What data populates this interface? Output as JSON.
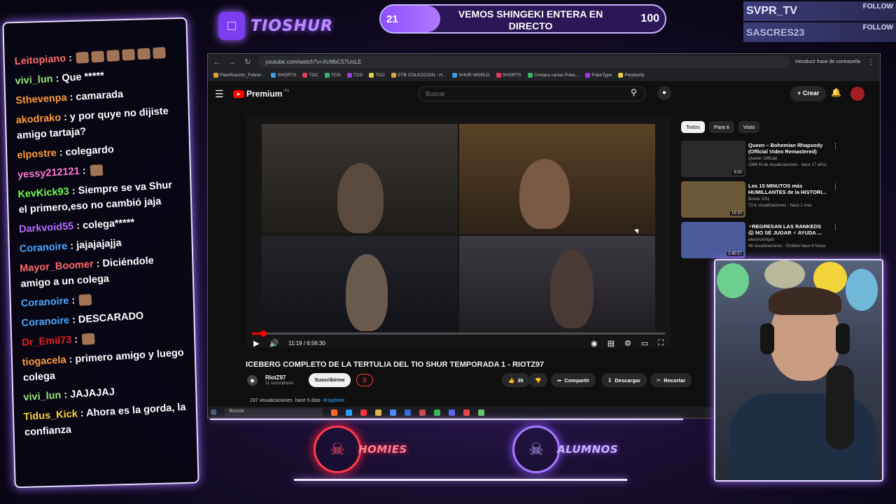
{
  "overlay": {
    "brand_name": "TIOSHUR",
    "goal": {
      "current": "21",
      "target": "100",
      "title": "VEMOS SHINGEKI ENTERA EN DIRECTO",
      "progress": 0.21
    },
    "follow": [
      {
        "name": "SVPR_TV",
        "tag": "FOLLOW"
      },
      {
        "name": "SASCRES23",
        "tag": "FOLLOW"
      }
    ],
    "badges": {
      "left": "HOMIES",
      "right": "ALUMNOS"
    }
  },
  "chat": {
    "messages": [
      {
        "user": "Leitopiano",
        "color": "#ff6a6a",
        "text": "",
        "emotes": 6
      },
      {
        "user": "vivi_lun",
        "color": "#9ae57a",
        "text": "Que *****",
        "emotes": 0
      },
      {
        "user": "Sthevenpa",
        "color": "#ff9a3c",
        "text": "camarada",
        "emotes": 0
      },
      {
        "user": "akodrako",
        "color": "#ff9a3c",
        "text": "y por quye no dijiste amigo tartaja?",
        "emotes": 0
      },
      {
        "user": "elpostre",
        "color": "#ff9a3c",
        "text": "colegardo",
        "emotes": 0
      },
      {
        "user": "yessy212121",
        "color": "#ff7ad9",
        "text": "",
        "emotes": 1
      },
      {
        "user": "KevKick93",
        "color": "#6eff4a",
        "text": "Siempre se va Shur el primero,eso no cambió jaja",
        "emotes": 0
      },
      {
        "user": "Darkvoid55",
        "color": "#b46cff",
        "text": "colega*****",
        "emotes": 0
      },
      {
        "user": "Coranoire",
        "color": "#4aa8ff",
        "text": "jajajajajja",
        "emotes": 0
      },
      {
        "user": "Mayor_Boomer",
        "color": "#ff6a6a",
        "text": "Diciéndole amigo a un colega",
        "emotes": 0
      },
      {
        "user": "Coranoire",
        "color": "#4aa8ff",
        "text": "",
        "emotes": 1
      },
      {
        "user": "Coranoire",
        "color": "#4aa8ff",
        "text": "DESCARADO",
        "emotes": 0
      },
      {
        "user": "Dr_Emil73",
        "color": "#e02020",
        "text": "",
        "emotes": 1
      },
      {
        "user": "tiogacela",
        "color": "#ff9a3c",
        "text": "primero amigo y luego colega",
        "emotes": 0
      },
      {
        "user": "vivi_lun",
        "color": "#9ae57a",
        "text": "JAJAJAJ",
        "emotes": 0
      },
      {
        "user": "Tidus_Kick",
        "color": "#ffd23c",
        "text": "Ahora es la gorda, la confianza",
        "emotes": 0
      }
    ]
  },
  "browser": {
    "url": "youtube.com/watch?v=XcMbC57UoLE",
    "password_hint": "Introducir frase de contraseña",
    "bookmarks": [
      "Planificación_Febrer...",
      "SHORTS",
      "TGC",
      "TCG",
      "TCG",
      "TGC",
      "ETB COLECCION - H...",
      "SHUR WORLD",
      "SHORTS",
      "Compra cartas Poke...",
      "PokeType",
      "Perplexity"
    ]
  },
  "youtube": {
    "logo": "Premium",
    "region": "ES",
    "search_placeholder": "Buscar",
    "create_label": "Crear",
    "player": {
      "time": "11:19 / 6:56:30",
      "progress": 0.027
    },
    "video_title": "ICEBERG COMPLETO DE LA TERTULIA DEL TIO SHUR TEMPORADA 1 - RIOTZ97",
    "channel": {
      "name": "RIotZ97",
      "subs": "11 suscriptores"
    },
    "subscribe_label": "Suscribirme",
    "likes": "35",
    "share_label": "Compartir",
    "download_label": "Descargar",
    "clip_label": "Recortar",
    "views": "237 visualizaciones",
    "age": "hace 5 días",
    "hashtag": "#Uppbeat",
    "filters": [
      "Todos",
      "Para ti",
      "Visto"
    ],
    "recommendations": [
      {
        "title": "Queen – Bohemian Rhapsody (Official Video Remastered)",
        "channel": "Queen Official",
        "meta": "1986 M de visualizaciones · hace 17 años",
        "duration": "6:00",
        "color": "#2a2a2a"
      },
      {
        "title": "Los 15 MINUTOS más HUMILLANTES de la HISTORI...",
        "channel": "Boxer XXL",
        "meta": "73 K visualizaciones · hace 1 mes",
        "duration": "19:20",
        "color": "#6a5a3a"
      },
      {
        "title": "⚡REGRESAN LAS RANKEDS 😱 NO SÉ JUGAR ⚡ AYUDA ...",
        "channel": "electroninja0",
        "meta": "46 visualizaciones · Emitido hace 6 horas",
        "duration": "2:40:57",
        "color": "#4a5a9a"
      }
    ]
  },
  "taskbar": {
    "search_placeholder": "Buscar"
  }
}
